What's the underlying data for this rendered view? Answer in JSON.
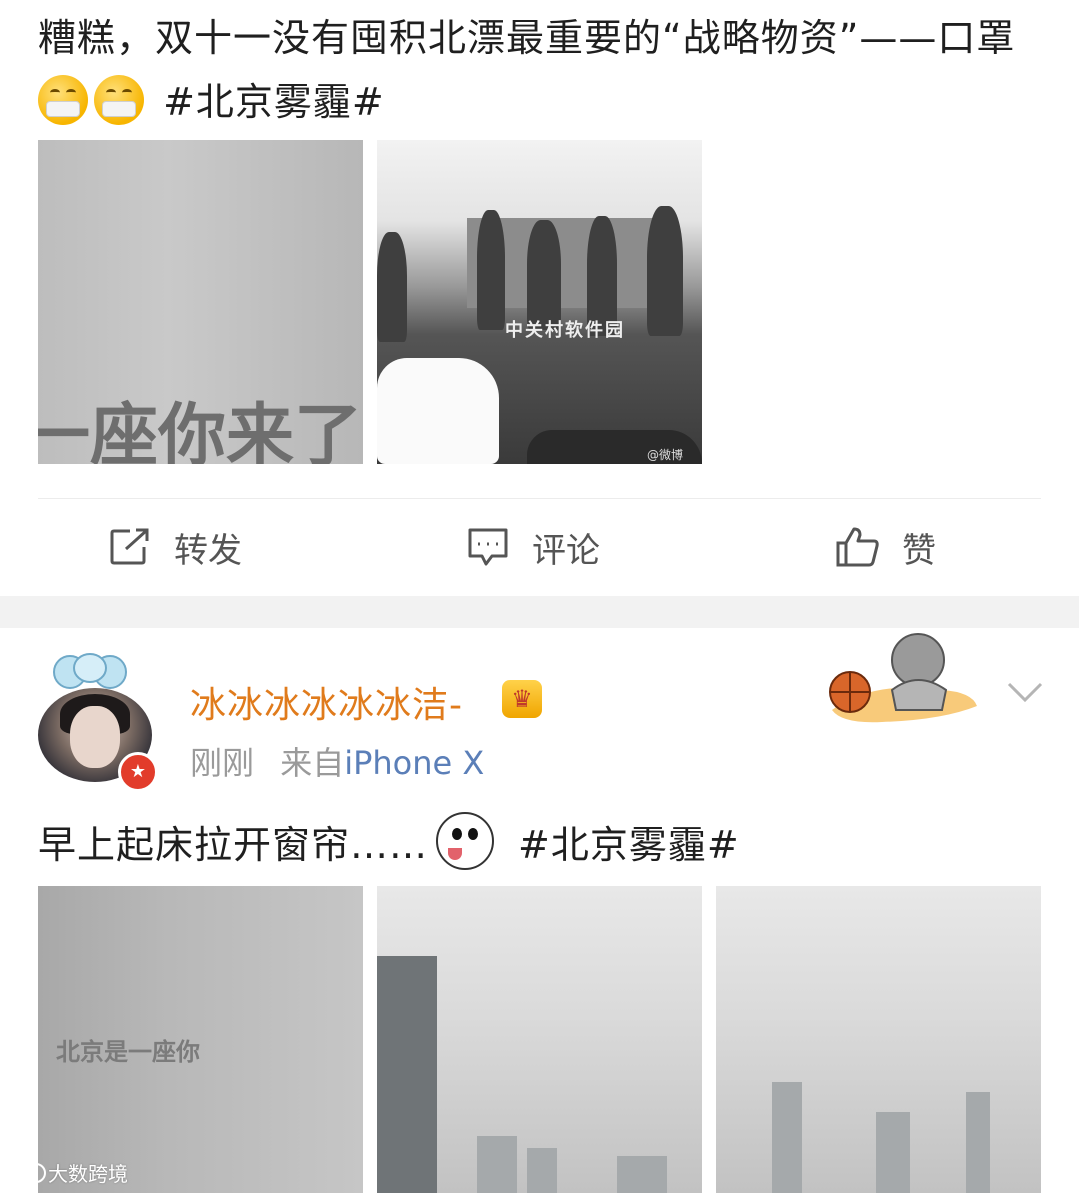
{
  "post1": {
    "text": "糟糕，双十一没有囤积北漂最重要的“战略物资”——口罩",
    "topic": "#北京雾霾#",
    "emoji_icon": "mask-face-emoji",
    "images": [
      {
        "type": "text-card",
        "overlay_text": "一座你来了"
      },
      {
        "type": "photo",
        "sign_text": "中关村软件园",
        "watermark": "@微博"
      }
    ],
    "actions": [
      {
        "icon": "share-icon",
        "label": "转发"
      },
      {
        "icon": "comment-icon",
        "label": "评论"
      },
      {
        "icon": "thumbs-up-icon",
        "label": "赞"
      }
    ]
  },
  "post2": {
    "username": "冰冰冰冰冰冰洁-",
    "time": "刚刚",
    "source_prefix": "来自",
    "device": "iPhone X",
    "text": "早上起床拉开窗帘……",
    "topic": "#北京雾霾#",
    "emoji_icon": "husky-dog-emoji",
    "images": [
      {
        "type": "text-card",
        "overlay_text": "北京是一座你"
      },
      {
        "type": "photo"
      },
      {
        "type": "photo"
      }
    ]
  },
  "watermark": {
    "label": "大数跨境"
  },
  "colors": {
    "username": "#e07b1c",
    "device": "#5b7fb8",
    "meta": "#9a9a9a",
    "action_text": "#555555",
    "band": "#f2f2f2"
  }
}
